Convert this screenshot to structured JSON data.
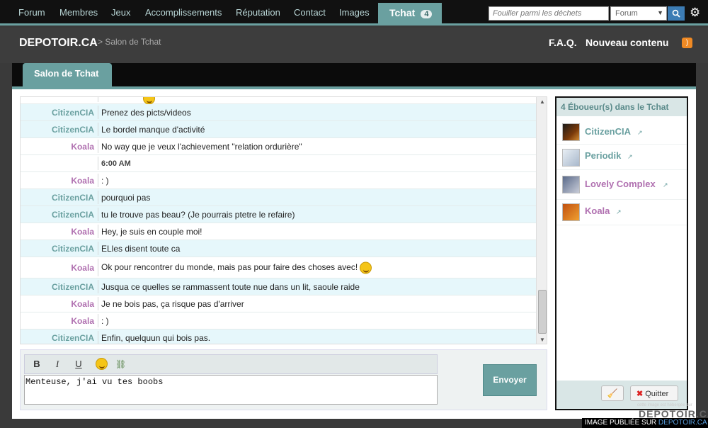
{
  "nav": {
    "items": [
      "Forum",
      "Membres",
      "Jeux",
      "Accomplissements",
      "Réputation",
      "Contact",
      "Images"
    ],
    "tchat_label": "Tchat",
    "tchat_count": "4",
    "search_placeholder": "Fouiller parmi les déchets",
    "search_scope": "Forum",
    "search_icon": "search-icon",
    "settings_icon": "gear-icon"
  },
  "header": {
    "site_title": "DEPOTOIR.CA",
    "breadcrumb": "> Salon de Tchat",
    "faq": "F.A.Q.",
    "new_content": "Nouveau contenu",
    "rss_icon": "rss-icon"
  },
  "page_tab": "Salon de Tchat",
  "messages": [
    {
      "author": "CitizenCIA",
      "text": "Prenez des picts/videos"
    },
    {
      "author": "CitizenCIA",
      "text": "Le bordel manque d'activité"
    },
    {
      "author": "Koala",
      "text": "No way que je veux l'achievement \"relation ordurière\""
    },
    {
      "author": "",
      "text": "6:00 AM"
    },
    {
      "author": "Koala",
      "text": ": )"
    },
    {
      "author": "CitizenCIA",
      "text": "pourquoi pas"
    },
    {
      "author": "CitizenCIA",
      "text": "tu le trouve pas beau? (Je pourrais ptetre le refaire)"
    },
    {
      "author": "Koala",
      "text": "Hey, je suis en couple moi!"
    },
    {
      "author": "CitizenCIA",
      "text": "ELles disent toute ca"
    },
    {
      "author": "Koala",
      "text": "Ok pour rencontrer du monde, mais pas pour faire des choses avec!"
    },
    {
      "author": "CitizenCIA",
      "text": "Jusqua ce quelles se rammassent toute nue dans un lit, saoule raide"
    },
    {
      "author": "Koala",
      "text": "Je ne bois pas, ça risque pas d'arriver"
    },
    {
      "author": "Koala",
      "text": ": )"
    },
    {
      "author": "CitizenCIA",
      "text": "Enfin, quelquun qui bois pas."
    }
  ],
  "compose": {
    "bold": "B",
    "italic": "I",
    "underline": "U",
    "input_value": "Menteuse, j'ai vu tes boobs",
    "send_label": "Envoyer"
  },
  "users_panel": {
    "title": "4 Éboueur(s) dans le Tchat",
    "users": [
      {
        "name": "CitizenCIA"
      },
      {
        "name": "Periodik"
      },
      {
        "name": "Lovely Complex"
      },
      {
        "name": "Koala"
      }
    ],
    "quit_label": "Quitter"
  },
  "watermark": {
    "small": "cette image est hébergée sur",
    "logo": "DEPOTOIR.CA",
    "bar_prefix": "IMAGE PUBLIÉE SUR ",
    "bar_site": "DEPOTOIR.CA"
  }
}
